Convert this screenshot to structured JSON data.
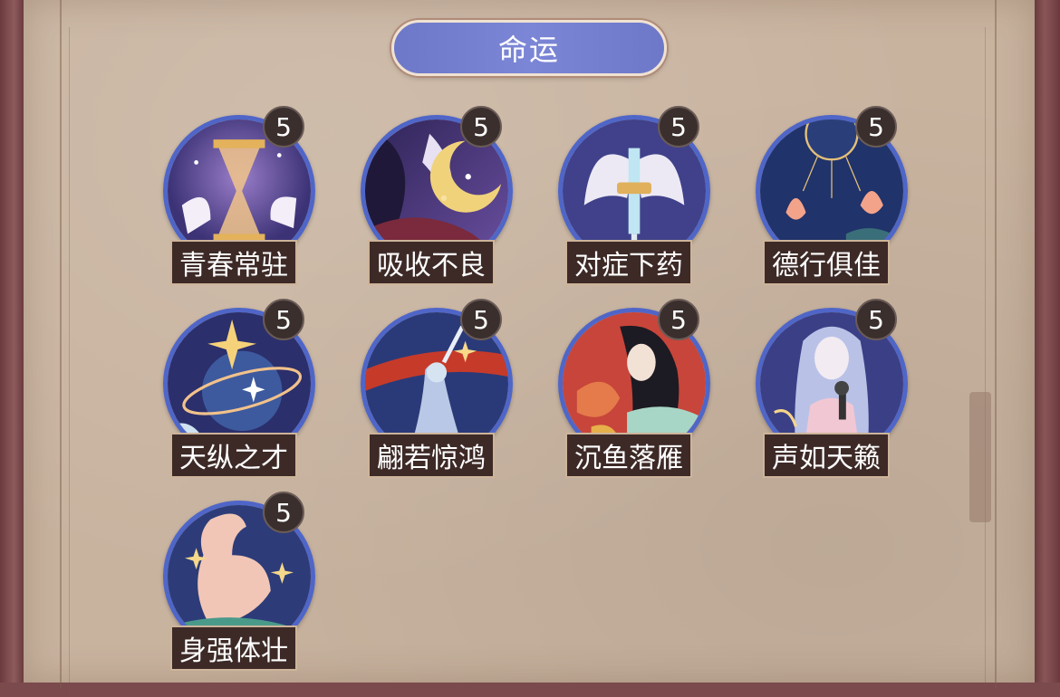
{
  "header": {
    "title": "命运"
  },
  "colors": {
    "header_bg": "#7c86d6",
    "ring": "#4f66c8",
    "badge_bg": "#3a2f2d",
    "label_bg": "#3d2a27",
    "paper": "#c8b39f"
  },
  "cards": [
    {
      "label": "青春常驻",
      "level": "5",
      "icon": "hourglass-icon"
    },
    {
      "label": "吸收不良",
      "level": "5",
      "icon": "night-woman-icon"
    },
    {
      "label": "对症下药",
      "level": "5",
      "icon": "winged-syringe-icon"
    },
    {
      "label": "德行俱佳",
      "level": "5",
      "icon": "sun-lotus-icon"
    },
    {
      "label": "天纵之才",
      "level": "5",
      "icon": "star-orb-icon"
    },
    {
      "label": "翩若惊鸿",
      "level": "5",
      "icon": "dancer-icon"
    },
    {
      "label": "沉鱼落雁",
      "level": "5",
      "icon": "fish-beauty-icon"
    },
    {
      "label": "声如天籁",
      "level": "5",
      "icon": "singer-icon"
    },
    {
      "label": "身强体壮",
      "level": "5",
      "icon": "muscle-arm-icon"
    }
  ]
}
